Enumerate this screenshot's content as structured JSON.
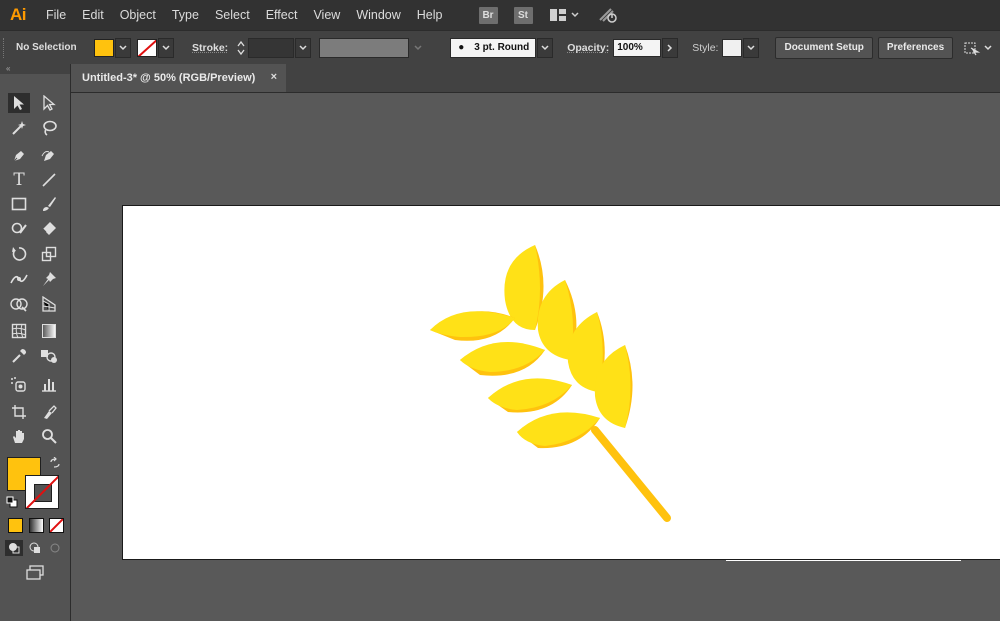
{
  "app": {
    "logo": "Ai"
  },
  "menu": {
    "items": [
      "File",
      "Edit",
      "Object",
      "Type",
      "Select",
      "Effect",
      "View",
      "Window",
      "Help"
    ],
    "bridge": "Br",
    "stock": "St"
  },
  "control_bar": {
    "selection": "No Selection",
    "fill_color": "#ffc20e",
    "stroke_label": "Stroke:",
    "brush": "3 pt. Round",
    "opacity_label": "Opacity:",
    "opacity_value": "100%",
    "style_label": "Style:",
    "document_setup": "Document Setup",
    "preferences": "Preferences"
  },
  "document": {
    "tab_title": "Untitled-3* @ 50% (RGB/Preview)",
    "close_glyph": "×"
  },
  "toolbar": {
    "collapse_glyph": "«",
    "fill_color": "#ffc20e",
    "type_tool_glyph": "T"
  },
  "colors": {
    "accent": "#ff9a00",
    "wheat_light": "#ffe117",
    "wheat_dark": "#ffc20e"
  }
}
